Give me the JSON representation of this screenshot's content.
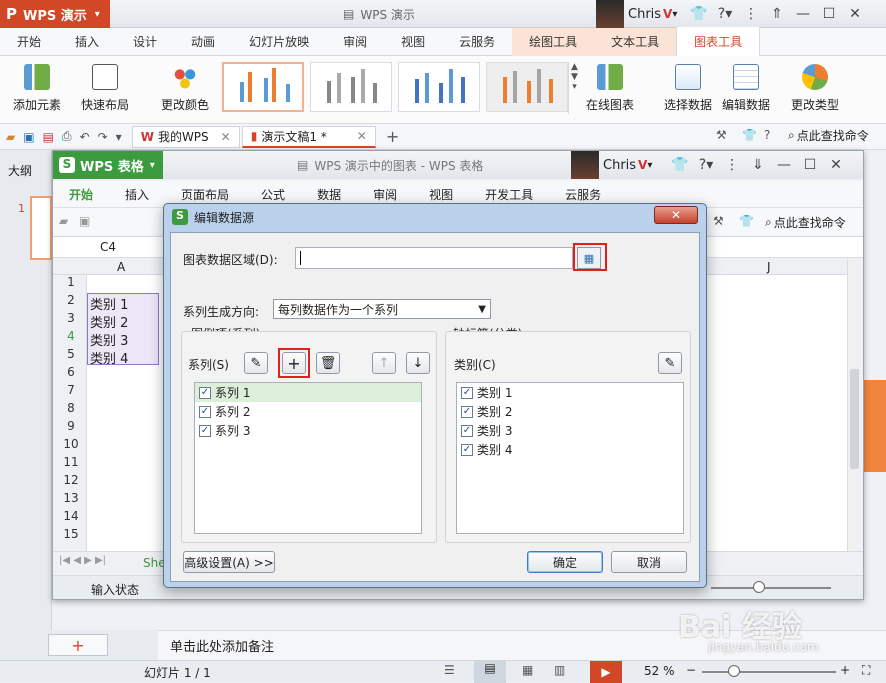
{
  "ppt": {
    "logo": "WPS 演示",
    "window_title": "WPS 演示",
    "user": "Chris",
    "tabs": [
      "开始",
      "插入",
      "设计",
      "动画",
      "幻灯片放映",
      "审阅",
      "视图",
      "云服务",
      "绘图工具",
      "文本工具",
      "图表工具"
    ],
    "ribbon": [
      "添加元素",
      "快速布局",
      "更改颜色",
      "在线图表",
      "选择数据",
      "编辑数据",
      "更改类型"
    ],
    "quick_tabs": [
      "我的WPS",
      "演示文稿1 *"
    ],
    "search_label": "点此查找命令",
    "left_pane_tab": "大纲",
    "slide_number": "1",
    "notes": "单击此处添加备注",
    "slide_count": "幻灯片 1 / 1",
    "zoom": "52 %"
  },
  "et": {
    "logo": "WPS 表格",
    "window_title": "WPS 演示中的图表 - WPS 表格",
    "user": "Chris",
    "tabs": [
      "开始",
      "插入",
      "页面布局",
      "公式",
      "数据",
      "审阅",
      "视图",
      "开发工具",
      "云服务"
    ],
    "search_label": "点此查找命令",
    "cell_ref": "C4",
    "col_a": "A",
    "col_j": "J",
    "rows": [
      "1",
      "2",
      "3",
      "4",
      "5",
      "6",
      "7",
      "8",
      "9",
      "10",
      "11",
      "12",
      "13",
      "14",
      "15"
    ],
    "cells": [
      "类别 1",
      "类别 2",
      "类别 3",
      "类别 4"
    ],
    "sheet_tab": "She",
    "status": "输入状态"
  },
  "dialog": {
    "title": "编辑数据源",
    "range_label": "图表数据区域(D):",
    "range_value": "",
    "direction_label": "系列生成方向:",
    "direction_value": "每列数据作为一个系列",
    "legend_group": "图例项(系列)",
    "series_label": "系列(S)",
    "series": [
      "系列 1",
      "系列 2",
      "系列 3"
    ],
    "axis_group": "轴标签(分类)",
    "category_label": "类别(C)",
    "categories": [
      "类别 1",
      "类别 2",
      "类别 3",
      "类别 4"
    ],
    "advanced": "高级设置(A) >>",
    "ok": "确定",
    "cancel": "取消"
  },
  "watermark": {
    "brand": "Bai 经验",
    "url": "jingyan.baidu.com"
  },
  "colors": {
    "ppt_brand": "#d24726",
    "et_brand": "#3c9a3f",
    "highlight": "#e02020",
    "selected": "#dcefd8"
  }
}
